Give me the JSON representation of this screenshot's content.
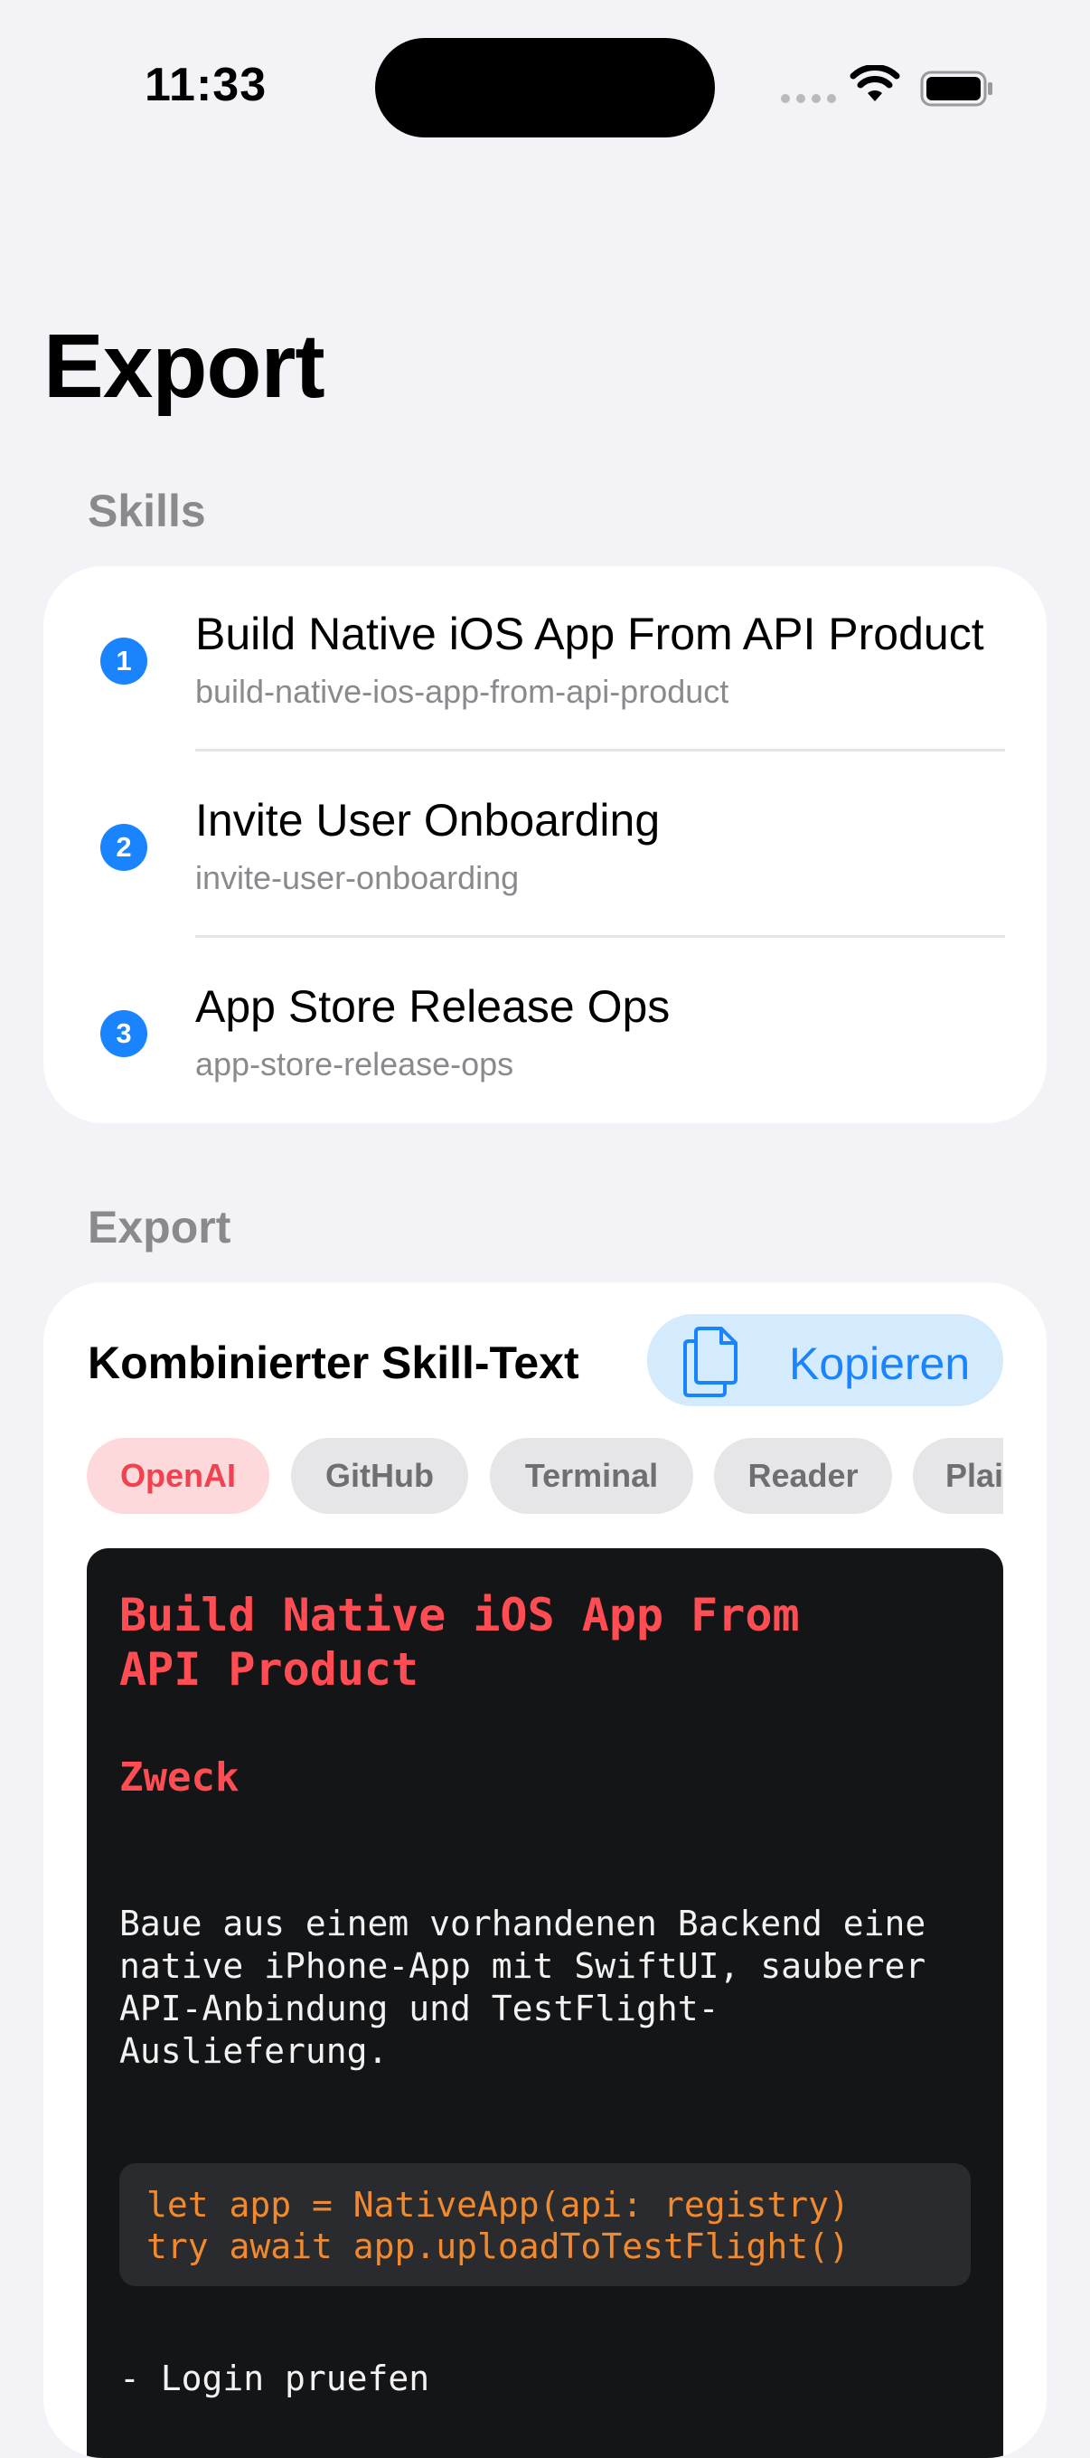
{
  "status_bar": {
    "time": "11:33"
  },
  "nav": {
    "large_title": "Export"
  },
  "skills_section": {
    "header": "Skills",
    "items": [
      {
        "index": "1",
        "title": "Build Native iOS App From API Product",
        "slug": "build-native-ios-app-from-api-product"
      },
      {
        "index": "2",
        "title": "Invite User Onboarding",
        "slug": "invite-user-onboarding"
      },
      {
        "index": "3",
        "title": "App Store Release Ops",
        "slug": "app-store-release-ops"
      }
    ]
  },
  "export_section": {
    "header": "Export",
    "card_title": "Kombinierter Skill-Text",
    "copy_label": "Kopieren",
    "formats": [
      "OpenAI",
      "GitHub",
      "Terminal",
      "Reader",
      "Plain"
    ],
    "selected_format": "OpenAI",
    "preview": {
      "h1_line1": "Build Native iOS App From",
      "h1_line2": "API Product",
      "h2": "Zweck",
      "paragraph": "Baue aus einem vorhandenen Backend eine native iPhone-App mit SwiftUI, sauberer API-Anbindung und TestFlight-Auslieferung.",
      "code_lines": [
        "let app = NativeApp(api: registry)",
        "try await app.uploadToTestFlight()"
      ],
      "list_item": "- Login pruefen"
    }
  },
  "colors": {
    "accent": "#1a84ff",
    "accent_bg": "#d4eafd",
    "chip_active_bg": "#fdd9db",
    "chip_active_text": "#f0424f",
    "code_bg": "#141517",
    "heading_red": "#ff4d53",
    "code_orange": "#f08a30"
  },
  "icons": {
    "signal": "cellular-signal-icon",
    "wifi": "wifi-icon",
    "battery": "battery-icon",
    "copy": "copy-documents-icon"
  }
}
